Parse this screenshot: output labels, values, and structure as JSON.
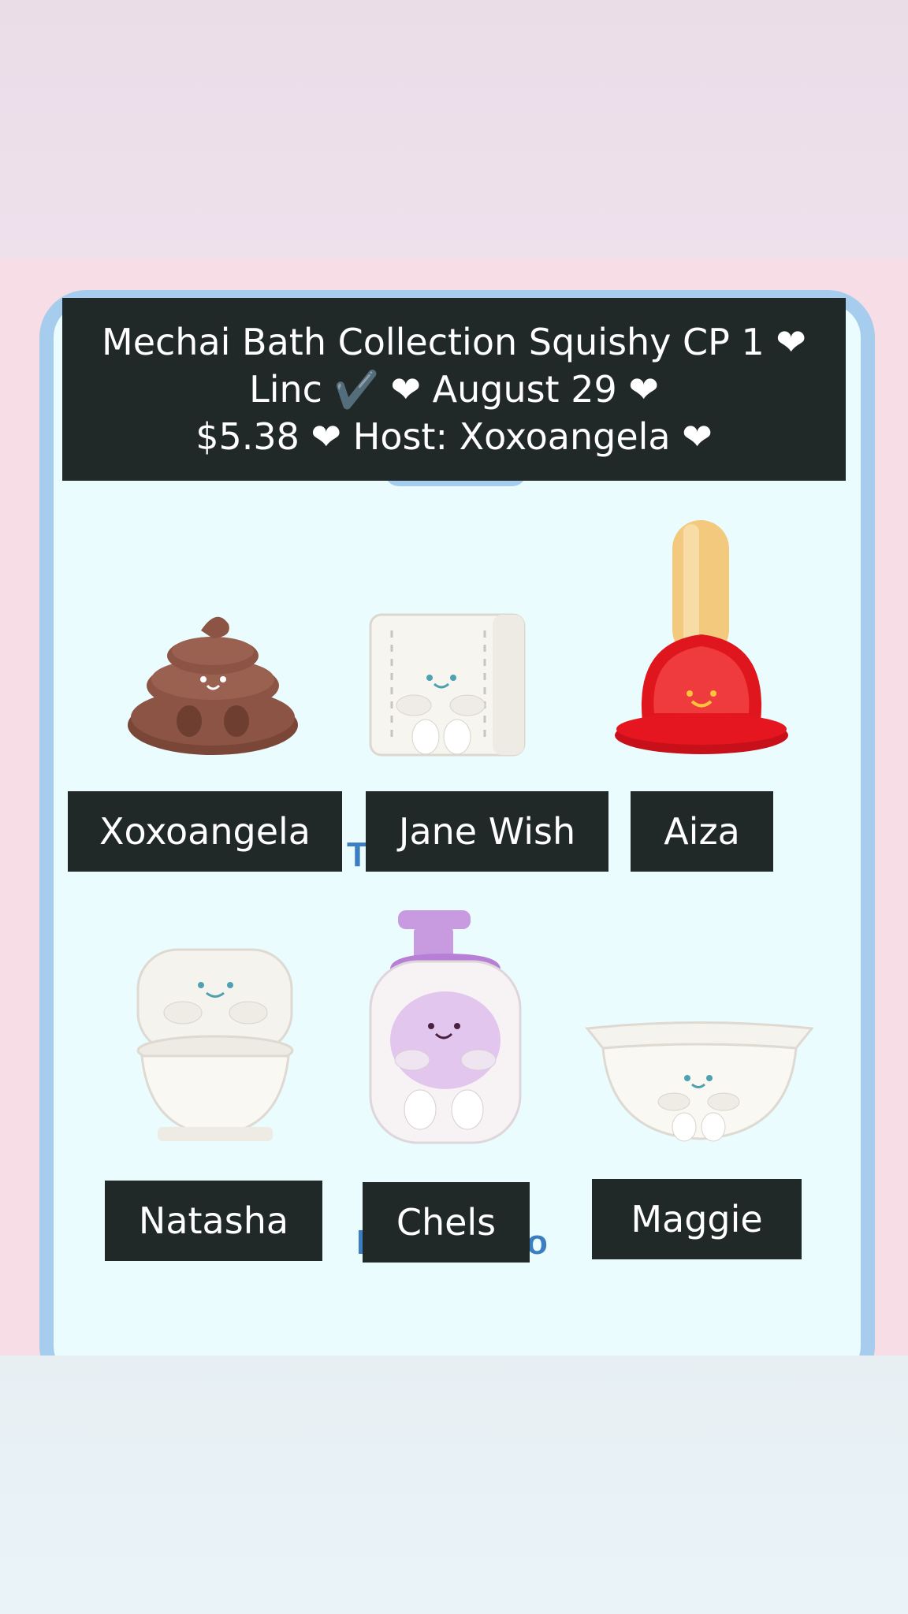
{
  "header": {
    "line1": "Mechai Bath Collection Squishy CP 1 ❤",
    "line2": "Linc ✔️ ❤ August 29 ❤",
    "line3": "$5.38 ❤ Host: Xoxoangela ❤"
  },
  "grid": {
    "items": [
      {
        "label": "Xoxoangela",
        "icon": "poop-squishy-icon"
      },
      {
        "label": "Jane Wish",
        "icon": "toilet-paper-squishy-icon"
      },
      {
        "label": "Aiza",
        "icon": "plunger-squishy-icon"
      },
      {
        "label": "Natasha",
        "icon": "toilet-squishy-icon"
      },
      {
        "label": "Chels",
        "icon": "soap-bottle-squishy-icon"
      },
      {
        "label": "Maggie",
        "icon": "bathtub-squishy-icon"
      }
    ]
  },
  "colors": {
    "label_bg": "#212828",
    "frame": "#a7cdee",
    "screen": "#eafcfd",
    "background": "#f7dde6"
  }
}
